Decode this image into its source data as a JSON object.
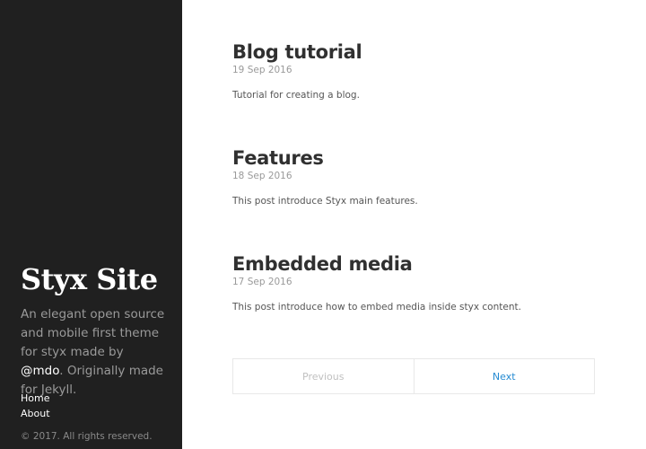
{
  "sidebar": {
    "site_title": "Styx Site",
    "description_before": "An elegant open source and mobile first theme for styx made by ",
    "handle": "@mdo",
    "description_after": ". Originally made for Jekyll.",
    "nav": [
      {
        "label": "Home"
      },
      {
        "label": "About"
      }
    ],
    "copyright": "© 2017. All rights reserved."
  },
  "posts": [
    {
      "title": "Blog tutorial",
      "date": "19 Sep 2016",
      "excerpt": "Tutorial for creating a blog."
    },
    {
      "title": "Features",
      "date": "18 Sep 2016",
      "excerpt": "This post introduce Styx main features."
    },
    {
      "title": "Embedded media",
      "date": "17 Sep 2016",
      "excerpt": "This post introduce how to embed media inside styx content."
    }
  ],
  "pagination": {
    "previous_label": "Previous",
    "next_label": "Next"
  },
  "colors": {
    "sidebar_bg": "#202020",
    "link_accent": "#268bd2"
  }
}
